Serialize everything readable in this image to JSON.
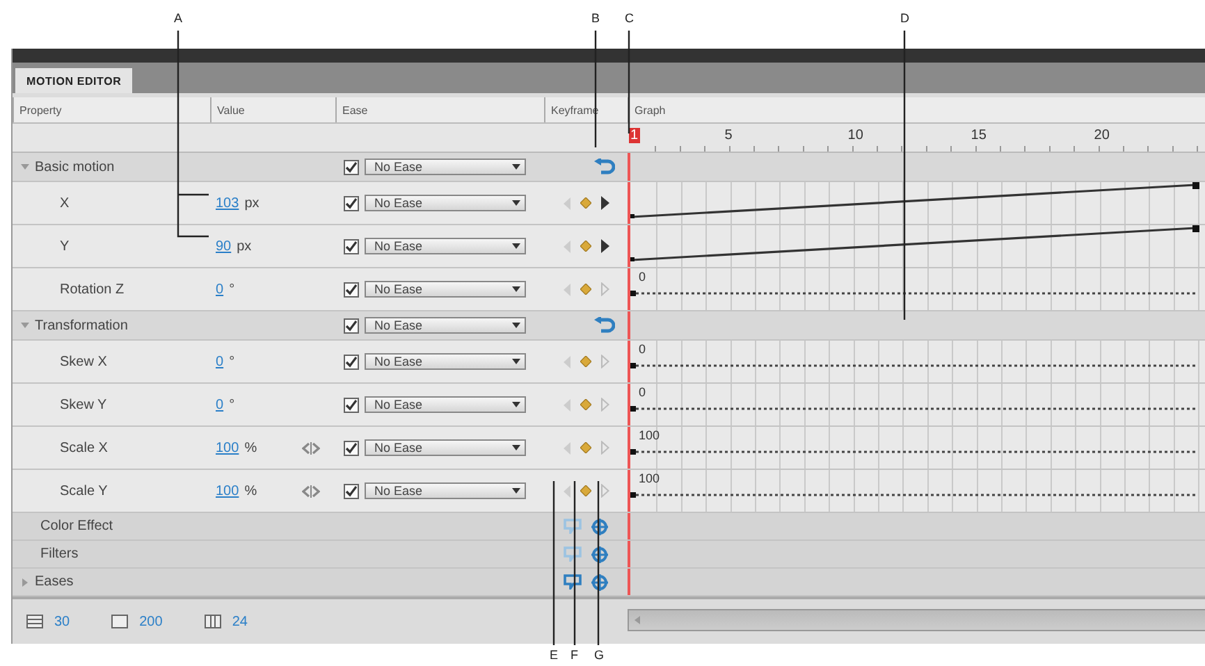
{
  "panel": {
    "tab": "MOTION EDITOR"
  },
  "columns": [
    "Property",
    "Value",
    "Ease",
    "Keyframe",
    "Graph"
  ],
  "ruler": [
    "1",
    "5",
    "10",
    "15",
    "20"
  ],
  "rows": [
    {
      "kind": "section",
      "label": "Basic motion",
      "expanded": true,
      "ease_checked": true,
      "ease": "No Ease"
    },
    {
      "kind": "property",
      "label": "X",
      "value": "103",
      "unit": "px",
      "ease_checked": true,
      "ease": "No Ease",
      "next_enabled": true,
      "graph": {
        "kind": "rising"
      }
    },
    {
      "kind": "property",
      "label": "Y",
      "value": "90",
      "unit": "px",
      "ease_checked": true,
      "ease": "No Ease",
      "next_enabled": true,
      "graph": {
        "kind": "rising"
      }
    },
    {
      "kind": "property",
      "label": "Rotation Z",
      "value": "0",
      "unit": "°",
      "ease_checked": true,
      "ease": "No Ease",
      "next_enabled": false,
      "graph": {
        "kind": "flat",
        "label": "0"
      }
    },
    {
      "kind": "section",
      "label": "Transformation",
      "expanded": true,
      "ease_checked": true,
      "ease": "No Ease"
    },
    {
      "kind": "property",
      "label": "Skew X",
      "value": "0",
      "unit": "°",
      "ease_checked": true,
      "ease": "No Ease",
      "next_enabled": false,
      "graph": {
        "kind": "flat",
        "label": "0"
      }
    },
    {
      "kind": "property",
      "label": "Skew Y",
      "value": "0",
      "unit": "°",
      "ease_checked": true,
      "ease": "No Ease",
      "next_enabled": false,
      "graph": {
        "kind": "flat",
        "label": "0"
      }
    },
    {
      "kind": "property",
      "label": "Scale X",
      "value": "100",
      "unit": "%",
      "linked": true,
      "ease_checked": true,
      "ease": "No Ease",
      "next_enabled": false,
      "graph": {
        "kind": "flat",
        "label": "100"
      }
    },
    {
      "kind": "property",
      "label": "Scale Y",
      "value": "100",
      "unit": "%",
      "linked": true,
      "ease_checked": true,
      "ease": "No Ease",
      "next_enabled": false,
      "graph": {
        "kind": "flat",
        "label": "100"
      }
    },
    {
      "kind": "category",
      "label": "Color Effect",
      "paste_enabled": false
    },
    {
      "kind": "category",
      "label": "Filters",
      "paste_enabled": false
    },
    {
      "kind": "category",
      "label": "Eases",
      "expanded": false,
      "paste_enabled": true
    }
  ],
  "footer": [
    {
      "value": "30"
    },
    {
      "value": "200"
    },
    {
      "value": "24"
    }
  ],
  "callouts": [
    "A",
    "B",
    "C",
    "D",
    "E",
    "F",
    "G"
  ]
}
